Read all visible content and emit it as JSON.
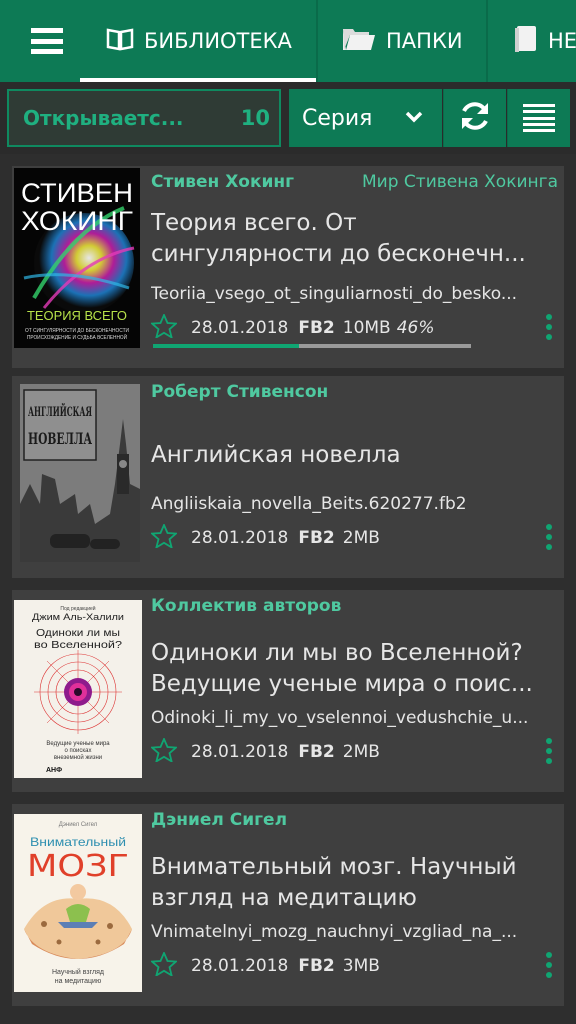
{
  "tabs": {
    "library_label": "БИБЛИОТЕКА",
    "folders_label": "ПАПКИ",
    "new_label": "НЕ"
  },
  "filter": {
    "query": "Открываетс...",
    "count": "10",
    "sort_label": "Серия"
  },
  "books": [
    {
      "author": "Стивен Хокинг",
      "series": "Мир Стивена Хокинга",
      "title": "Теория всего. От\nсингулярности до бесконечн...",
      "filename": "Teoriia_vsego_ot_singuliarnosti_do_besko...",
      "date": "28.01.2018",
      "format": "FB2",
      "size": "10MB",
      "progress": "46%",
      "progress_fraction": 0.46,
      "cover": {
        "top_line": "СТИВЕН",
        "bottom_line": "ХОКИНГ",
        "title_line": "ТЕОРИЯ ВСЕГО",
        "sub1": "ОТ СИНГУЛЯРНОСТИ ДО БЕСКОНЕЧНОСТИ",
        "sub2": "ПРОИСХОЖДЕНИЕ И СУДЬБА ВСЕЛЕННОЙ"
      }
    },
    {
      "author": "Роберт Стивенсон",
      "series": "",
      "title": "Английская новелла",
      "filename": "Angliiskaia_novella_Beits.620277.fb2",
      "date": "28.01.2018",
      "format": "FB2",
      "size": "2MB",
      "cover": {
        "line1": "АНГЛИЙСКАЯ",
        "line2": "НОВЕЛЛА"
      }
    },
    {
      "author": "Коллектив авторов",
      "series": "",
      "title": "Одиноки ли мы во Вселенной?\nВедущие ученые мира о поис...",
      "filename": "Odinoki_li_my_vo_vselennoi_vedushchie_u...",
      "date": "28.01.2018",
      "format": "FB2",
      "size": "2MB",
      "cover": {
        "editor": "Под редакцией",
        "author": "Джим Аль-Халили",
        "line1": "Одиноки ли мы",
        "line2": "во Вселенной?",
        "sub1": "Ведущие ученые мира",
        "sub2": "о поисках",
        "sub3": "внеземной жизни",
        "pub": "АНФ"
      }
    },
    {
      "author": "Дэниел Сигел",
      "series": "",
      "title": "Внимательный мозг. Научный\nвзгляд на медитацию",
      "filename": "Vnimatelnyi_mozg_nauchnyi_vzgliad_na_...",
      "date": "28.01.2018",
      "format": "FB2",
      "size": "3MB",
      "cover": {
        "author": "Дэниел Сигел",
        "line1": "Внимательный",
        "line2": "МОЗГ",
        "sub1": "Научный взгляд",
        "sub2": "на медитацию"
      }
    }
  ]
}
